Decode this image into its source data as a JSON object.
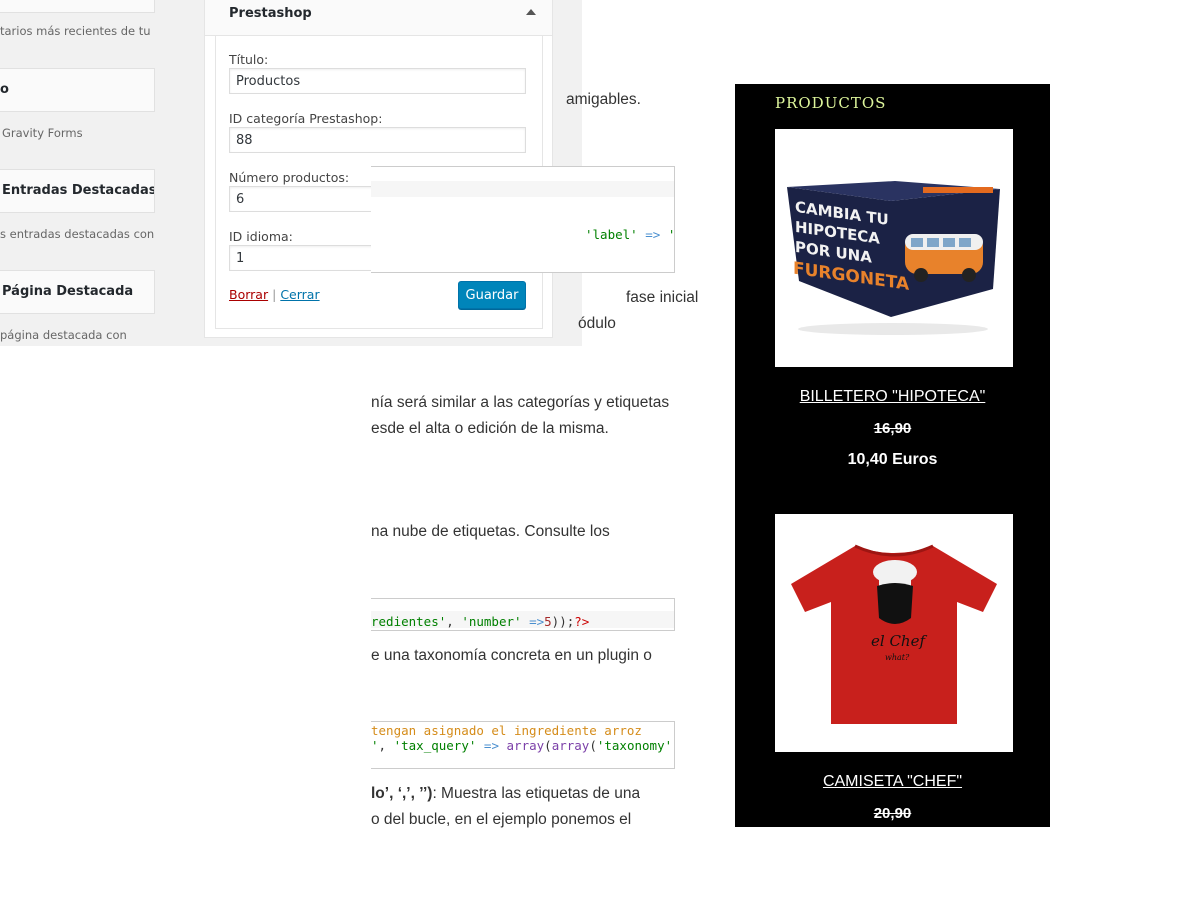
{
  "admin": {
    "available_widgets": [
      {
        "label": "",
        "desc": "tarios más recientes de tu"
      },
      {
        "label": "o",
        "desc": "Gravity Forms"
      },
      {
        "label": "Entradas Destacadas",
        "desc": "s entradas destacadas con"
      },
      {
        "label": "Página Destacada",
        "desc": "página destacada con"
      }
    ],
    "form": {
      "widget_title": "Prestashop",
      "fields": [
        {
          "label": "Título:",
          "value": "Productos"
        },
        {
          "label": "ID categoría Prestashop:",
          "value": "88"
        },
        {
          "label": "Número productos:",
          "value": "6"
        },
        {
          "label": "ID idioma:",
          "value": "1"
        }
      ],
      "delete_label": "Borrar",
      "separator": "|",
      "close_label": "Cerrar",
      "save_label": "Guardar"
    }
  },
  "article": {
    "paragraphs": [
      "amigables.",
      "fase inicial",
      "ódulo",
      "nía será similar a las categorías y etiquetas",
      "esde el alta o edición de la misma.",
      "na nube de etiquetas. Consulte los",
      "e una taxonomía concreta en un plugin o",
      "o del bucle, en el ejemplo ponemos el"
    ],
    "code1": {
      "str1": "'label'",
      "op": "=>",
      "str2": "'l"
    },
    "code2": {
      "str1": "redientes'",
      "sep": ", ",
      "str2": "'number'",
      "op": "=>",
      "num": "5",
      "tail": "));",
      "php": "?>"
    },
    "code3": {
      "comment": "tengan asignado el ingrediente arroz",
      "str1": "'",
      "sep": ", ",
      "str2": "'tax_query'",
      "op": "=>",
      "fn1": "array",
      "p1": "(",
      "fn2": "array",
      "p2": "(",
      "str3": "'taxonomy'",
      "op2": "=>"
    },
    "bold_snippet": "lo’, ‘,’, ’’)",
    "after_bold": ": Muestra las etiquetas de una"
  },
  "products_widget": {
    "title": "PRODUCTOS",
    "items": [
      {
        "name": "BILLETERO \"HIPOTECA\"",
        "old_price": "16,90",
        "new_price": "10,40 Euros",
        "image_text": [
          "CAMBIA TU",
          "HIPOTECA",
          "POR UNA",
          "FURGONETA"
        ]
      },
      {
        "name": "CAMISETA \"CHEF\"",
        "old_price": "20,90",
        "image_text": [
          "el Chef",
          "what?"
        ]
      }
    ]
  }
}
